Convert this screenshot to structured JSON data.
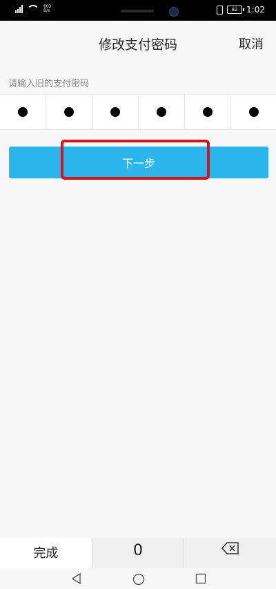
{
  "status": {
    "speed_value": "602",
    "speed_unit": "B/s",
    "battery": "82",
    "time": "1:02"
  },
  "header": {
    "title": "修改支付密码",
    "cancel_label": "取消"
  },
  "password": {
    "hint": "请输入旧的支付密码",
    "digits": 6
  },
  "next_button_label": "下一步",
  "keyboard": {
    "done_label": "完成",
    "zero_label": "0"
  },
  "icons": {
    "backspace": "backspace-icon",
    "nav_back": "back-triangle-icon",
    "nav_home": "home-circle-icon",
    "nav_recent": "recent-square-icon"
  },
  "colors": {
    "accent": "#2bb5ec",
    "highlight": "#d4141c"
  }
}
